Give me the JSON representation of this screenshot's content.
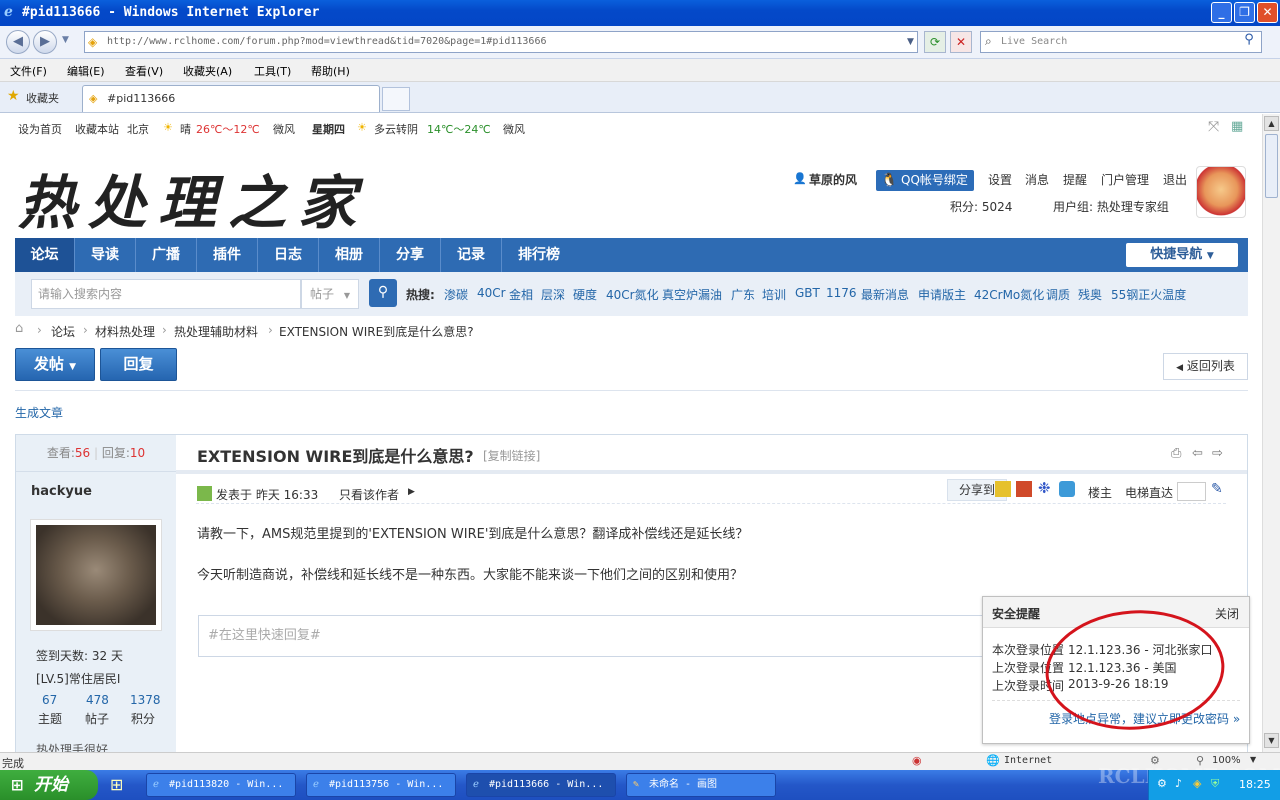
{
  "window": {
    "title": "#pid113666 - Windows Internet Explorer"
  },
  "toolbar": {
    "url": "http://www.rclhome.com/forum.php?mod=viewthread&tid=7020&page=1#pid113666",
    "search_placeholder": "Live Search"
  },
  "menu": [
    "文件(F)",
    "编辑(E)",
    "查看(V)",
    "收藏夹(A)",
    "工具(T)",
    "帮助(H)"
  ],
  "favorites": {
    "label": "收藏夹",
    "tab": "#pid113666"
  },
  "topbar": {
    "set_home": "设为首页",
    "bookmark": "收藏本站",
    "city": "北京",
    "weather1": "晴",
    "temp1": "26℃～12℃",
    "wind1": "微风",
    "day": "星期四",
    "weather2": "多云转阴",
    "temp2": "14℃～24℃",
    "wind2": "微风"
  },
  "header": {
    "username": "草原的风",
    "qq_bind": "QQ帐号绑定",
    "links": [
      "设置",
      "消息",
      "提醒",
      "门户管理",
      "退出"
    ],
    "points": "积分: 5024",
    "group": "用户组: 热处理专家组"
  },
  "logo": {
    "text": "热处理之家"
  },
  "nav": {
    "items": [
      "论坛",
      "导读",
      "广播",
      "插件",
      "日志",
      "相册",
      "分享",
      "记录",
      "排行榜"
    ],
    "quick": "快捷导航"
  },
  "search": {
    "placeholder": "请输入搜索内容",
    "type": "帖子",
    "hot_label": "热搜:",
    "hot": [
      "渗碳",
      "40Cr",
      "金相",
      "层深",
      "硬度",
      "40Cr氮化",
      "真空炉漏油",
      "广东",
      "培训",
      "GBT",
      "1176",
      "最新消息",
      "申请版主",
      "42CrMo氮化",
      "调质",
      "残奥",
      "55钢正火温度"
    ]
  },
  "breadcrumb": [
    "论坛",
    "材料热处理",
    "热处理辅助材料",
    "EXTENSION WIRE到底是什么意思?"
  ],
  "actions": {
    "post": "发帖",
    "reply": "回复",
    "back": "返回列表",
    "gen_article": "生成文章"
  },
  "thread": {
    "views_label": "查看:",
    "views": "56",
    "replies_label": "回复:",
    "replies": "10",
    "title": "EXTENSION WIRE到底是什么意思?",
    "copy_link": "[复制链接]"
  },
  "author": {
    "name": "hackyue",
    "checkin": "签到天数: 32 天",
    "level": "[LV.5]常住居民I",
    "stats": [
      {
        "n": "67",
        "l": "主题"
      },
      {
        "n": "478",
        "l": "帖子"
      },
      {
        "n": "1378",
        "l": "积分"
      }
    ],
    "more": "热处理手很好"
  },
  "post": {
    "posted": "发表于 昨天 16:33",
    "only_author": "只看该作者",
    "share": "分享到",
    "floor": "楼主",
    "elevator": "电梯直达",
    "body1": "请教一下，AMS规范里提到的'EXTENSION WIRE'到底是什么意思？翻译成补偿线还是延长线？",
    "body2": "今天听制造商说，补偿线和延长线不是一种东西。大家能不能来谈一下他们之间的区别和使用？",
    "quick_reply": "#在这里快速回复#"
  },
  "security": {
    "title": "安全提醒",
    "close": "关闭",
    "rows": [
      {
        "k": "本次登录位置",
        "v": "12.1.123.36 - 河北张家口"
      },
      {
        "k": "上次登录位置",
        "v": "12.1.123.36 - 美国"
      },
      {
        "k": "上次登录时间",
        "v": "2013-9-26 18:19"
      }
    ],
    "warning": "登录地点异常，建议立即更改密码 »"
  },
  "status": {
    "left": "完成",
    "zone": "Internet",
    "zoom": "100%"
  },
  "taskbar": {
    "start": "开始",
    "tasks": [
      "#pid113820 - Win...",
      "#pid113756 - Win...",
      "#pid113666 - Win...",
      "未命名 - 画图"
    ],
    "clock": "18:25",
    "watermark": "RCLHOME.COM"
  }
}
